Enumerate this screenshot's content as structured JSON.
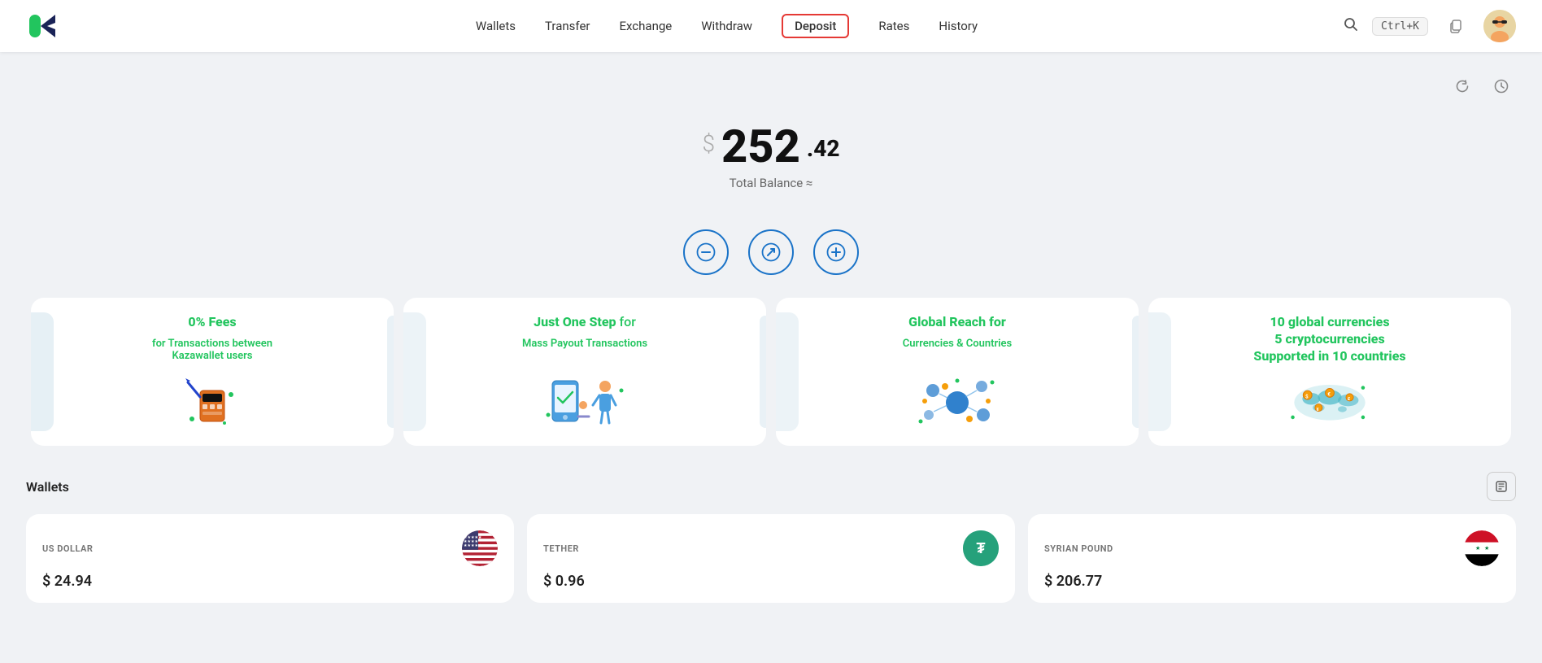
{
  "app": {
    "logo_letter": "K"
  },
  "navbar": {
    "links": [
      {
        "label": "Wallets",
        "key": "wallets",
        "active": false,
        "highlighted": false
      },
      {
        "label": "Transfer",
        "key": "transfer",
        "active": false,
        "highlighted": false
      },
      {
        "label": "Exchange",
        "key": "exchange",
        "active": false,
        "highlighted": false
      },
      {
        "label": "Withdraw",
        "key": "withdraw",
        "active": false,
        "highlighted": false
      },
      {
        "label": "Deposit",
        "key": "deposit",
        "active": false,
        "highlighted": true
      },
      {
        "label": "Rates",
        "key": "rates",
        "active": false,
        "highlighted": false
      },
      {
        "label": "History",
        "key": "history",
        "active": false,
        "highlighted": false
      }
    ],
    "search_shortcut": "Ctrl+K"
  },
  "balance": {
    "currency_symbol": "$",
    "integer": "252",
    "decimal": ".42",
    "label": "Total Balance ≈"
  },
  "action_buttons": [
    {
      "key": "withdraw",
      "icon": "−",
      "label": "Withdraw"
    },
    {
      "key": "exchange",
      "icon": "↗",
      "label": "Exchange"
    },
    {
      "key": "deposit",
      "icon": "+",
      "label": "Deposit"
    }
  ],
  "promo_cards": [
    {
      "title": "0% Fees",
      "subtitle": "for Transactions between\nKazawallet users",
      "illus": "fees"
    },
    {
      "title": "Just One Step",
      "title_light": "for",
      "subtitle": "Mass Payout Transactions",
      "illus": "payout"
    },
    {
      "title": "Global Reach for",
      "subtitle": "Currencies & Countries",
      "illus": "global"
    },
    {
      "title": "10 global currencies\n5 cryptocurrencies\nSupported in 10 countries",
      "illus": "currencies"
    }
  ],
  "wallets": {
    "title": "Wallets",
    "edit_label": "edit",
    "items": [
      {
        "currency": "US DOLLAR",
        "amount": "$ 24.94",
        "flag": "us"
      },
      {
        "currency": "TETHER",
        "amount": "$ 0.96",
        "flag": "usdt"
      },
      {
        "currency": "SYRIAN POUND",
        "amount": "$ 206.77",
        "flag": "sy"
      }
    ]
  },
  "colors": {
    "green": "#22c55e",
    "blue": "#1a73c8",
    "red": "#e53935"
  }
}
